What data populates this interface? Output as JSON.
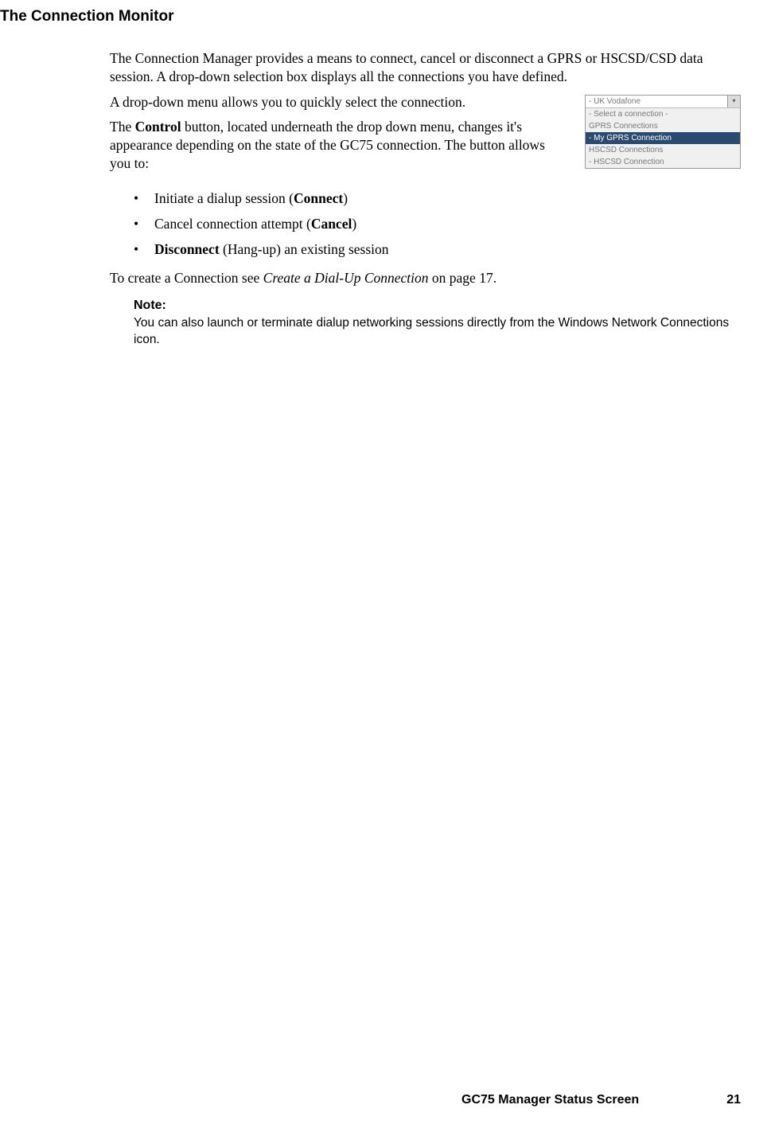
{
  "heading": "The Connection Monitor",
  "para1": "The Connection Manager provides a means to connect, cancel or disconnect a GPRS or HSCSD/CSD data session. A drop-down selection box displays all the connections you have defined.",
  "para2": "A drop-down menu allows you to quickly select the connection.",
  "para3_pre": "The ",
  "para3_bold": "Control",
  "para3_post": " button, located underneath the drop down menu, changes it's appearance depending on the state of the GC75 connection. The button allows you to:",
  "bullets": [
    {
      "pre": "Initiate a dialup session (",
      "bold": "Connect",
      "post": ")"
    },
    {
      "pre": "Cancel connection attempt (",
      "bold": "Cancel",
      "post": ")"
    },
    {
      "pre": "",
      "bold": "Disconnect",
      "post": " (Hang-up) an existing session"
    }
  ],
  "para4_pre": "To create a Connection see ",
  "para4_italic": "Create a Dial-Up Connection",
  "para4_post": " on page 17.",
  "note": {
    "label": "Note:",
    "text": "You can also launch or terminate dialup networking sessions directly from the Windows Network Connections icon."
  },
  "dropdown": {
    "selected": "- UK Vodafone",
    "select_prompt": "- Select a connection -",
    "group1": "GPRS Connections",
    "group1_item": "- My GPRS Connection",
    "group2": "HSCSD Connections",
    "group2_item": "- HSCSD Connection"
  },
  "footer": {
    "title": "GC75 Manager Status Screen",
    "page": "21"
  }
}
